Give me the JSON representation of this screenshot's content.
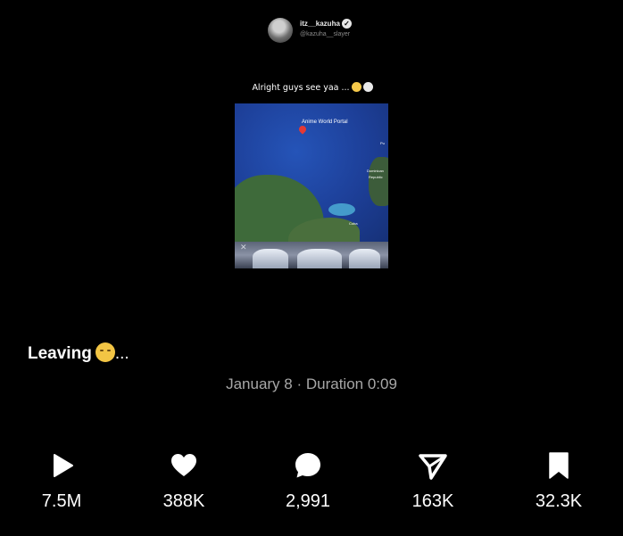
{
  "header": {
    "username": "itz__kazuha",
    "handle": "@kazuha__slayer"
  },
  "video": {
    "caption": "Alright guys see yaa ...",
    "map_labels": {
      "portal": "Anime World Portal",
      "dominican_1": "Dominican",
      "dominican_2": "Republic",
      "puerto": "Pu",
      "cuba": "Cuba"
    },
    "close_glyph": "✕"
  },
  "post": {
    "caption": "Leaving",
    "caption_suffix": "...",
    "meta": "January 8 · Duration 0:09"
  },
  "actions": [
    {
      "icon": "play-icon",
      "count": "7.5M"
    },
    {
      "icon": "heart-icon",
      "count": "388K"
    },
    {
      "icon": "comment-icon",
      "count": "2,991"
    },
    {
      "icon": "share-icon",
      "count": "163K"
    },
    {
      "icon": "bookmark-icon",
      "count": "32.3K"
    }
  ],
  "colors": {
    "background": "#000000",
    "text": "#ffffff",
    "meta_text": "#a7a7a7"
  }
}
